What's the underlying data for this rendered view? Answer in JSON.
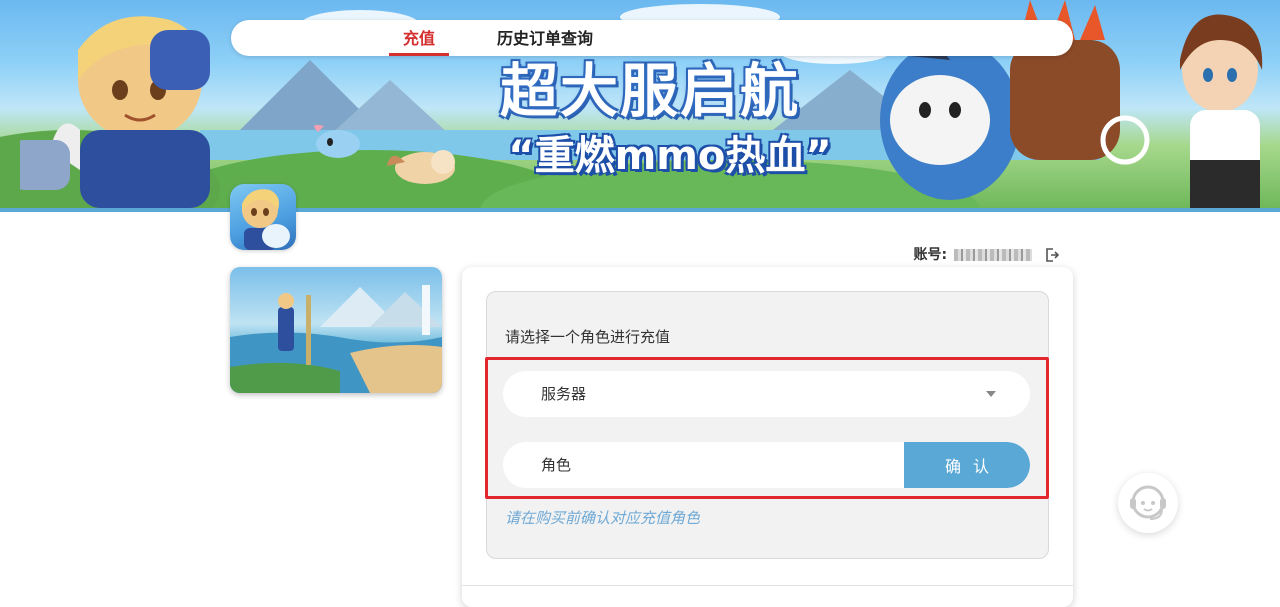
{
  "banner": {
    "title": "超大服启航",
    "subtitle": "“重燃mmo热血”"
  },
  "nav": {
    "tabs": [
      {
        "label": "充值",
        "active": true
      },
      {
        "label": "历史订单查询",
        "active": false
      }
    ],
    "active_color": "#d43030"
  },
  "account": {
    "label": "账号:",
    "logout_icon": "logout-icon"
  },
  "form": {
    "prompt": "请选择一个角色进行充值",
    "server_label": "服务器",
    "role_placeholder": "角色",
    "confirm_label": "确认",
    "hint": "请在购买前确认对应充值角色",
    "highlight_color": "#e3262e",
    "button_color": "#5aa8d6"
  },
  "support": {
    "icon": "customer-service-icon"
  }
}
